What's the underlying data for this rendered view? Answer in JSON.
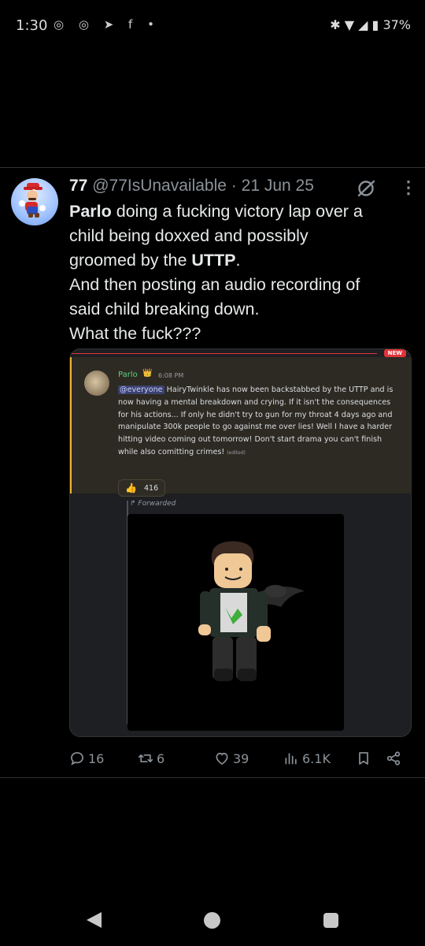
{
  "status_bar": {
    "time": "1:30",
    "left_icons": "◎ ◎ ➤ f •",
    "battery": "37%",
    "right_icons": "✱ ▼ ◢ ▮"
  },
  "tweet": {
    "display_name": "77",
    "handle": "@77IsUnavailable",
    "separator": "·",
    "date": "21 Jun 25",
    "more": "⋮",
    "body": {
      "line1_bold": "Parlo",
      "line1_rest": " doing a fucking victory lap over a",
      "line2": "child being doxxed and possibly",
      "line3_start": "groomed by the ",
      "line3_bold": "UTTP",
      "line3_end": ".",
      "line4": "And then posting an audio recording of",
      "line5": "said child breaking down.",
      "line6": "What the fuck???"
    }
  },
  "discord_message": {
    "new_badge": "NEW",
    "author": "Parlo",
    "crown": "👑",
    "time": "6:08 PM",
    "mention": "@everyone",
    "text": " HairyTwinkle has now been backstabbed by the UTTP and is now having a mental breakdown and crying. If it isn't the consequences for his actions... If only he didn't try to gun for my throat 4 days ago and manipulate 300k people to go against me over lies! Well I have a harder hitting video coming out tomorrow! Don't start drama you can't finish while also comitting crimes!",
    "edited": "(edited)",
    "reaction_emoji": "👍",
    "reaction_count": "416",
    "forwarded_label": "↱ Forwarded"
  },
  "actions": {
    "replies": "16",
    "reposts": "6",
    "likes": "39",
    "views": "6.1K"
  },
  "colors": {
    "background": "#000000",
    "text": "#e7e9ea",
    "muted": "#8b9298",
    "discord_highlight": "#2d2a23",
    "discord_accent": "#f0b232",
    "new_red": "#e2333a"
  }
}
